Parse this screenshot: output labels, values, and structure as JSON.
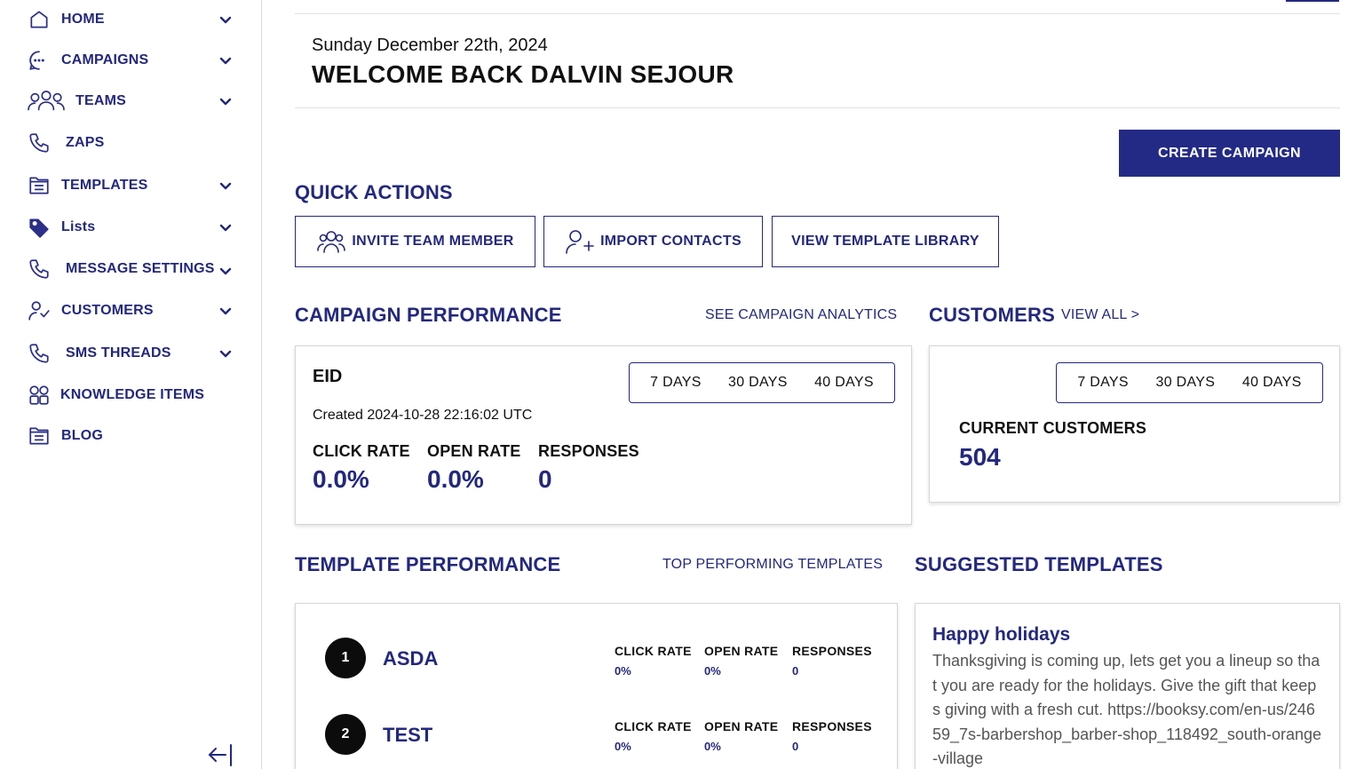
{
  "sidebar": {
    "items": [
      {
        "label": "HOME",
        "icon": "home-icon",
        "has_chevron": true
      },
      {
        "label": "CAMPAIGNS",
        "icon": "chat-bubble-icon",
        "has_chevron": true
      },
      {
        "label": "TEAMS",
        "icon": "team-icon",
        "has_chevron": true
      },
      {
        "label": "ZAPS",
        "icon": "phone-icon",
        "has_chevron": false
      },
      {
        "label": "TEMPLATES",
        "icon": "folder-icon",
        "has_chevron": true
      },
      {
        "label": "Lists",
        "icon": "tag-icon",
        "has_chevron": true
      },
      {
        "label": "MESSAGE SETTINGS",
        "icon": "phone-icon",
        "has_chevron": true
      },
      {
        "label": "CUSTOMERS",
        "icon": "user-check-icon",
        "has_chevron": true
      },
      {
        "label": "SMS THREADS",
        "icon": "phone-icon",
        "has_chevron": true
      },
      {
        "label": "KNOWLEDGE ITEMS",
        "icon": "grid-icon",
        "has_chevron": false
      },
      {
        "label": "BLOG",
        "icon": "folder-icon",
        "has_chevron": false
      }
    ],
    "collapse_icon": "collapse-arrow-icon"
  },
  "header": {
    "date": "Sunday December 22th, 2024",
    "welcome": "WELCOME BACK DALVIN SEJOUR"
  },
  "actions": {
    "create_campaign": "CREATE CAMPAIGN"
  },
  "quick_actions": {
    "title": "QUICK ACTIONS",
    "buttons": [
      {
        "label": "INVITE TEAM MEMBER",
        "icon": "team-icon"
      },
      {
        "label": "IMPORT CONTACTS",
        "icon": "user-plus-icon"
      },
      {
        "label": "VIEW TEMPLATE LIBRARY"
      }
    ]
  },
  "campaign_performance": {
    "title": "CAMPAIGN PERFORMANCE",
    "link": "SEE CAMPAIGN ANALYTICS",
    "ranges": [
      "7 DAYS",
      "30 DAYS",
      "40 DAYS"
    ],
    "campaign": {
      "name": "EID",
      "created": "Created 2024-10-28 22:16:02 UTC",
      "metrics": [
        {
          "label": "CLICK RATE",
          "value": "0.0%"
        },
        {
          "label": "OPEN RATE",
          "value": "0.0%"
        },
        {
          "label": "RESPONSES",
          "value": "0"
        }
      ]
    }
  },
  "customers": {
    "title": "CUSTOMERS",
    "link": "VIEW ALL >",
    "ranges": [
      "7 DAYS",
      "30 DAYS",
      "40 DAYS"
    ],
    "current_label": "CURRENT CUSTOMERS",
    "current_value": "504"
  },
  "template_performance": {
    "title": "TEMPLATE PERFORMANCE",
    "link": "TOP PERFORMING TEMPLATES",
    "rows": [
      {
        "rank": "1",
        "name": "ASDA",
        "metrics": [
          {
            "label": "CLICK RATE",
            "value": "0%"
          },
          {
            "label": "OPEN RATE",
            "value": "0%"
          },
          {
            "label": "RESPONSES",
            "value": "0"
          }
        ]
      },
      {
        "rank": "2",
        "name": "TEST",
        "metrics": [
          {
            "label": "CLICK RATE",
            "value": "0%"
          },
          {
            "label": "OPEN RATE",
            "value": "0%"
          },
          {
            "label": "RESPONSES",
            "value": "0"
          }
        ]
      }
    ]
  },
  "suggested_templates": {
    "title": "SUGGESTED TEMPLATES",
    "items": [
      {
        "title": "Happy holidays",
        "body": "Thanksgiving is coming up, lets get you a lineup so that you are ready for the holidays. Give the gift that keeps giving with a fresh cut. https://booksy.com/en-us/24659_7s-barbershop_barber-shop_118492_south-orange-village"
      }
    ]
  },
  "colors": {
    "brand": "#23287e",
    "button": "#232a86"
  }
}
